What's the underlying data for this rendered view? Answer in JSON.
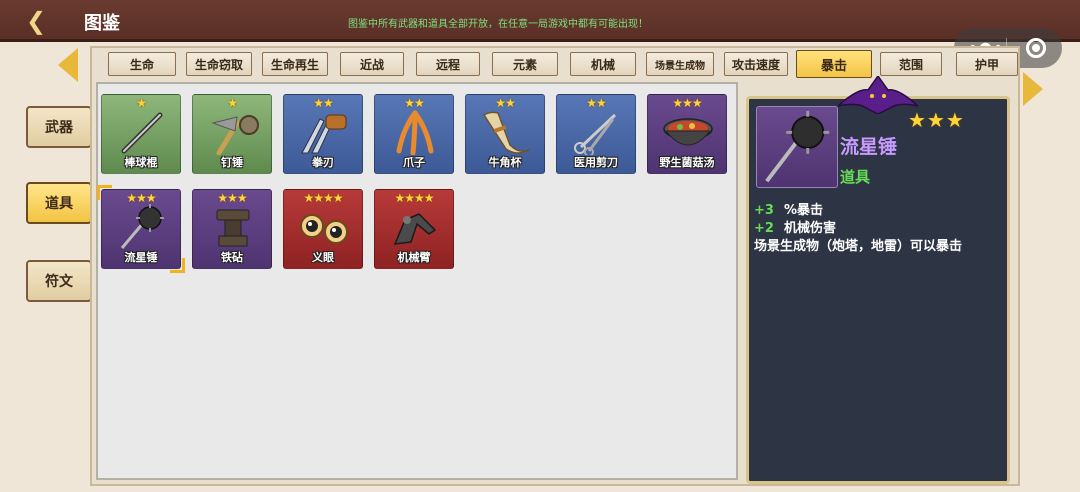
{
  "header": {
    "title": "图鉴",
    "notice": "图鉴中所有武器和道具全部开放，在任意一局游戏中都有可能出现！",
    "back_icon": "back-arrow-icon"
  },
  "capsule": {
    "more_icon": "more-dots-icon",
    "close_icon": "target-ring-icon"
  },
  "side_tabs": [
    {
      "label": "武器",
      "active": false
    },
    {
      "label": "道具",
      "active": true
    },
    {
      "label": "符文",
      "active": false
    }
  ],
  "category_tabs": [
    {
      "label": "生命"
    },
    {
      "label": "生命窃取"
    },
    {
      "label": "生命再生"
    },
    {
      "label": "近战"
    },
    {
      "label": "远程"
    },
    {
      "label": "元素"
    },
    {
      "label": "机械"
    },
    {
      "label": "场景生成物"
    },
    {
      "label": "攻击速度"
    },
    {
      "label": "暴击",
      "active": true
    },
    {
      "label": "范围"
    },
    {
      "label": "护甲"
    }
  ],
  "items": [
    {
      "name": "棒球棍",
      "stars": "★",
      "rarity": "green"
    },
    {
      "name": "钉锤",
      "stars": "★",
      "rarity": "green"
    },
    {
      "name": "拳刃",
      "stars": "★★",
      "rarity": "blue"
    },
    {
      "name": "爪子",
      "stars": "★★",
      "rarity": "blue"
    },
    {
      "name": "牛角杯",
      "stars": "★★",
      "rarity": "blue"
    },
    {
      "name": "医用剪刀",
      "stars": "★★",
      "rarity": "blue"
    },
    {
      "name": "野生菌菇汤",
      "stars": "★★★",
      "rarity": "purple"
    },
    {
      "name": "流星锤",
      "stars": "★★★",
      "rarity": "purple",
      "selected": true
    },
    {
      "name": "铁砧",
      "stars": "★★★",
      "rarity": "purple"
    },
    {
      "name": "义眼",
      "stars": "★★★★",
      "rarity": "red"
    },
    {
      "name": "机械臂",
      "stars": "★★★★",
      "rarity": "red"
    }
  ],
  "detail": {
    "name": "流星锤",
    "type": "道具",
    "stars": "★★★",
    "stats": [
      {
        "value": "+3",
        "text": "%暴击"
      },
      {
        "value": "+2",
        "text": "机械伤害"
      }
    ],
    "description": "场景生成物（炮塔，地雷）可以暴击"
  },
  "colors": {
    "accent": "#f2c443",
    "panel": "#2d3444",
    "bonus": "#66dd55",
    "name": "#c89bff"
  }
}
